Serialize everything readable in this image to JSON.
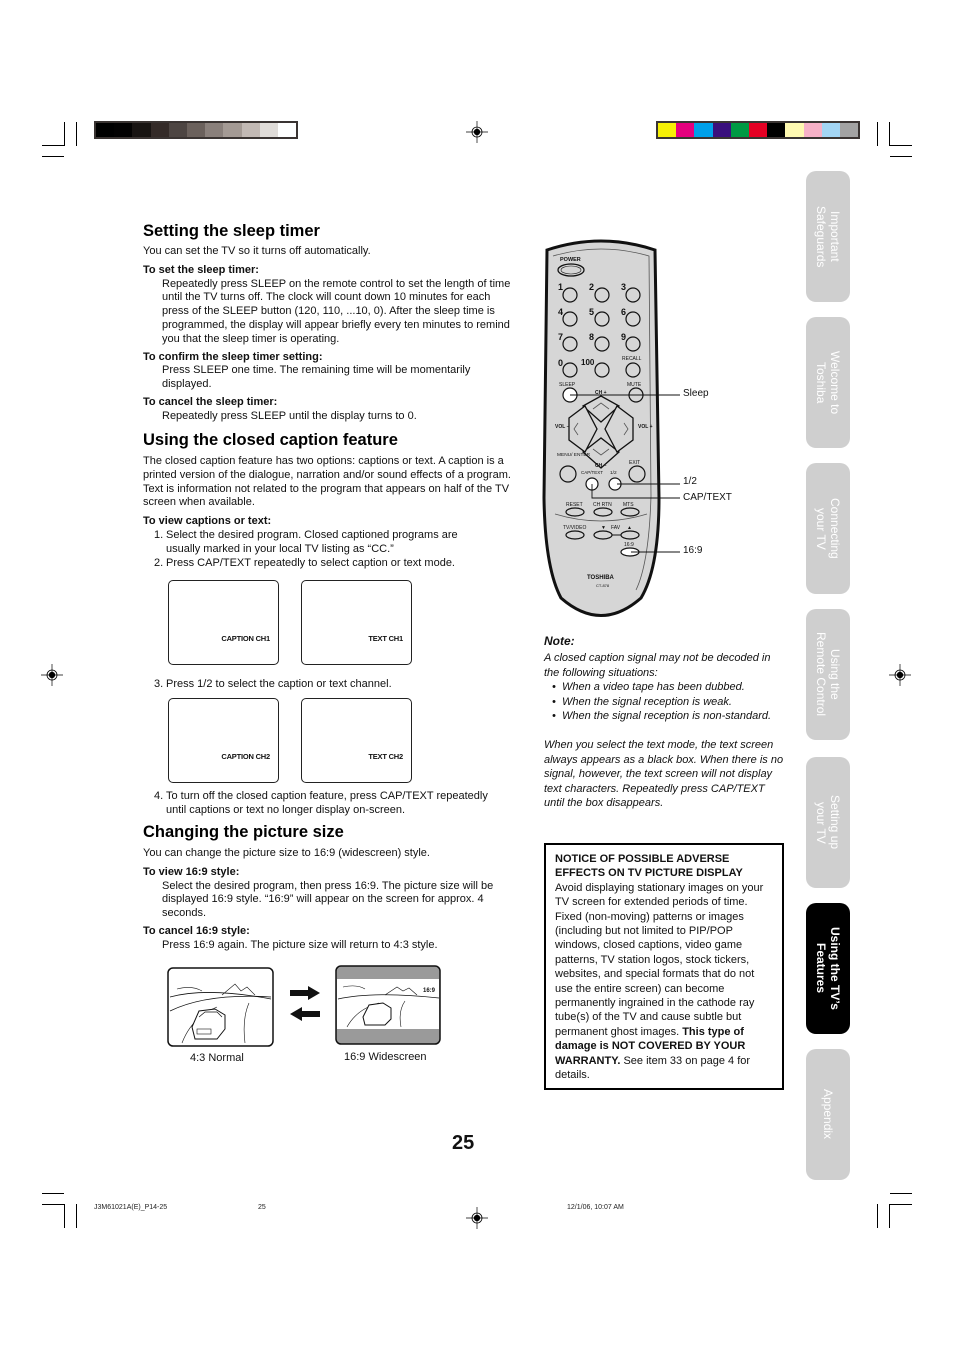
{
  "color_bars": {
    "grayscale": [
      "#000000",
      "#030202",
      "#181412",
      "#342b28",
      "#4d4542",
      "#6b615c",
      "#8a807b",
      "#a49a94",
      "#c2b9b4",
      "#e0dcd8",
      "#ffffff"
    ],
    "process": [
      "#f7f006",
      "#e6007e",
      "#00a0e9",
      "#3a0f7d",
      "#009a44",
      "#e60024",
      "#000000",
      "#fff9b1",
      "#f7b1c7",
      "#a3d5f3",
      "#a3a3a3"
    ]
  },
  "sleep_timer": {
    "title": "Setting the sleep timer",
    "intro": "You can set the TV so it turns off automatically.",
    "set_heading": "To set the sleep timer:",
    "set_body": "Repeatedly press SLEEP on the remote control to set the length of time until the TV turns off. The clock will count down 10 minutes for each press of the SLEEP button (120, 110, ...10, 0). After the sleep time is programmed, the display will appear briefly every ten minutes to remind you that the sleep timer is operating.",
    "confirm_heading": "To confirm the sleep timer setting:",
    "confirm_body": "Press SLEEP one time. The remaining time will be momentarily displayed.",
    "cancel_heading": "To cancel the sleep timer:",
    "cancel_body": "Repeatedly press SLEEP until the display turns to 0."
  },
  "closed_caption": {
    "title": "Using the closed caption feature",
    "intro": "The closed caption feature has two options: captions or text. A caption is a printed version of the dialogue, narration and/or sound effects of a program. Text is information not related to the program that appears on half of the TV screen when available.",
    "view_heading": "To view captions or text:",
    "steps": [
      {
        "num": "1.",
        "text": "Select the desired program. Closed captioned programs are usually marked in your local TV listing as “CC.”"
      },
      {
        "num": "2.",
        "text": "Press CAP/TEXT repeatedly to select caption or text mode."
      },
      {
        "num": "3.",
        "text": "Press 1/2 to select the caption or text channel."
      },
      {
        "num": "4.",
        "text": "To turn off the closed caption feature, press CAP/TEXT repeatedly until captions or text no longer display on-screen."
      }
    ],
    "screens": [
      "CAPTION CH1",
      "TEXT CH1",
      "CAPTION CH2",
      "TEXT CH2"
    ]
  },
  "picture_size": {
    "title": "Changing the picture size",
    "intro": "You can change the picture size to 16:9 (widescreen) style.",
    "view_heading": "To view 16:9 style:",
    "view_body": "Select the desired program, then press 16:9. The picture size will be displayed 16:9 style. “16:9” will appear on the screen for approx. 4 seconds.",
    "cancel_heading": "To cancel 16:9 style:",
    "cancel_body": "Press 16:9 again. The picture size will return to 4:3 style.",
    "normal_caption": "4:3 Normal",
    "wide_caption": "16:9 Widescreen",
    "wide_overlay": "16:9"
  },
  "remote": {
    "power": "POWER",
    "digits": [
      "1",
      "2",
      "3",
      "4",
      "5",
      "6",
      "7",
      "8",
      "9",
      "0",
      "100",
      "RECALL"
    ],
    "sleep": "SLEEP",
    "mute": "MUTE",
    "ch_up": "CH +",
    "ch_down": "CH –",
    "vol_minus": "VOL –",
    "vol_plus": "VOL +",
    "menu": "MENU/ ENTER",
    "exit": "EXIT",
    "captext": "CAP/TEXT",
    "half": "1/2",
    "reset": "RESET",
    "chrtn": "CH RTN",
    "mts": "MTS",
    "tvvideo": "TV/VIDEO",
    "fav_down": "▼",
    "fav": "FAV",
    "fav_up": "▲",
    "wide": "16:9",
    "brand": "TOSHIBA",
    "model": "CT-878",
    "callouts": {
      "sleep": "Sleep",
      "half": "1/2",
      "captext": "CAP/TEXT",
      "wide": "16:9"
    }
  },
  "note": {
    "title": "Note:",
    "intro": "A closed caption signal may not be decoded in the following situations:",
    "bullets": [
      "When a video tape has been dubbed.",
      "When the signal reception is weak.",
      "When the signal reception is non-standard."
    ],
    "para": "When you select the text mode, the text screen always appears as a black box. When there is no signal, however, the text screen will not display text characters. Repeatedly press CAP/TEXT until the box disappears."
  },
  "notice": {
    "title": "NOTICE OF POSSIBLE ADVERSE EFFECTS ON TV PICTURE DISPLAY",
    "body": "Avoid displaying stationary images on your TV screen for extended periods of time. Fixed (non-moving) patterns or images (including but not limited to PIP/POP windows, closed captions, video game patterns, TV station logos, stock tickers, websites, and special formats that do not use the entire screen) can become permanently ingrained in the cathode ray tube(s) of the TV and cause subtle but permanent ghost images.",
    "bold": "This type of damage is NOT COVERED BY YOUR WARRANTY.",
    "tail": "See item 33 on page 4 for details."
  },
  "sidebar": {
    "tabs": [
      {
        "label": "Important\nSafeguards",
        "active": false
      },
      {
        "label": "Welcome to\nToshiba",
        "active": false
      },
      {
        "label": "Connecting\nyour TV",
        "active": false
      },
      {
        "label": "Using the\nRemote Control",
        "active": false
      },
      {
        "label": "Setting up\nyour TV",
        "active": false
      },
      {
        "label": "Using the TV’s\nFeatures",
        "active": true
      },
      {
        "label": "Appendix",
        "active": false
      }
    ]
  },
  "page_number": "25",
  "footer": {
    "file": "J3M61021A(E)_P14-25",
    "page": "25",
    "timestamp": "12/1/06, 10:07 AM"
  }
}
